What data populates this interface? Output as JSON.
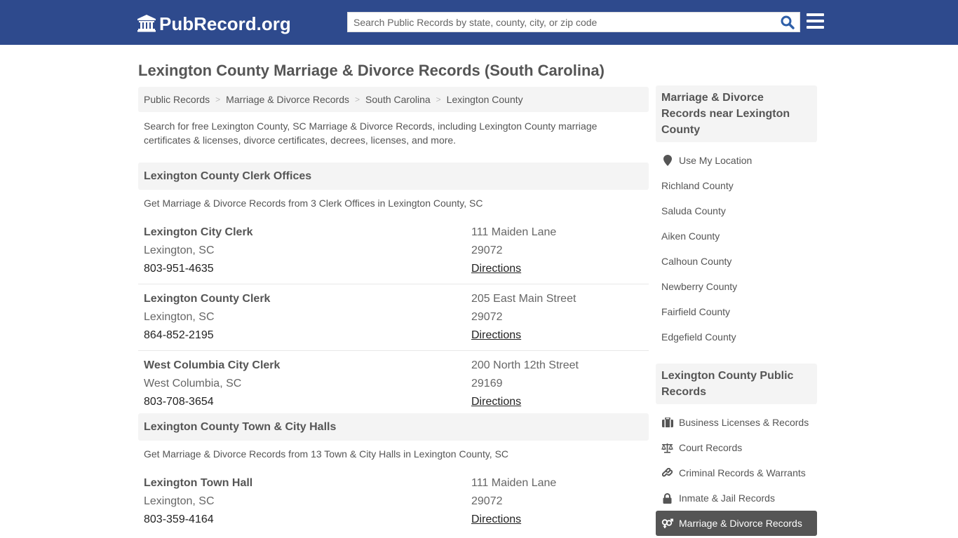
{
  "header": {
    "logo_text": "PubRecord.org",
    "search_placeholder": "Search Public Records by state, county, city, or zip code",
    "brand_color": "#2e4a8d"
  },
  "page_title": "Lexington County Marriage & Divorce Records (South Carolina)",
  "breadcrumb": [
    {
      "label": "Public Records"
    },
    {
      "label": "Marriage & Divorce Records"
    },
    {
      "label": "South Carolina"
    },
    {
      "label": "Lexington County"
    }
  ],
  "intro": "Search for free Lexington County, SC Marriage & Divorce Records, including Lexington County marriage certificates & licenses, divorce certificates, decrees, licenses, and more.",
  "sections": [
    {
      "title": "Lexington County Clerk Offices",
      "description": "Get Marriage & Divorce Records from 3 Clerk Offices in Lexington County, SC",
      "records": [
        {
          "name": "Lexington City Clerk",
          "city": "Lexington, SC",
          "phone": "803-951-4635",
          "address": "111 Maiden Lane",
          "zip": "29072",
          "link": "Directions"
        },
        {
          "name": "Lexington County Clerk",
          "city": "Lexington, SC",
          "phone": "864-852-2195",
          "address": "205 East Main Street",
          "zip": "29072",
          "link": "Directions"
        },
        {
          "name": "West Columbia City Clerk",
          "city": "West Columbia, SC",
          "phone": "803-708-3654",
          "address": "200 North 12th Street",
          "zip": "29169",
          "link": "Directions"
        }
      ]
    },
    {
      "title": "Lexington County Town & City Halls",
      "description": "Get Marriage & Divorce Records from 13 Town & City Halls in Lexington County, SC",
      "records": [
        {
          "name": "Lexington Town Hall",
          "city": "Lexington, SC",
          "phone": "803-359-4164",
          "address": "111 Maiden Lane",
          "zip": "29072",
          "link": "Directions"
        }
      ]
    }
  ],
  "sidebar": {
    "nearby_title": "Marriage & Divorce Records near Lexington County",
    "use_location": "Use My Location",
    "nearby": [
      "Richland County",
      "Saluda County",
      "Aiken County",
      "Calhoun County",
      "Newberry County",
      "Fairfield County",
      "Edgefield County"
    ],
    "public_title": "Lexington County Public Records",
    "public": [
      {
        "label": "Business Licenses & Records",
        "icon": "briefcase-icon"
      },
      {
        "label": "Court Records",
        "icon": "scale-icon"
      },
      {
        "label": "Criminal Records & Warrants",
        "icon": "link-icon"
      },
      {
        "label": "Inmate & Jail Records",
        "icon": "lock-icon"
      },
      {
        "label": "Marriage & Divorce Records",
        "icon": "marriage-icon",
        "active": true
      }
    ]
  }
}
